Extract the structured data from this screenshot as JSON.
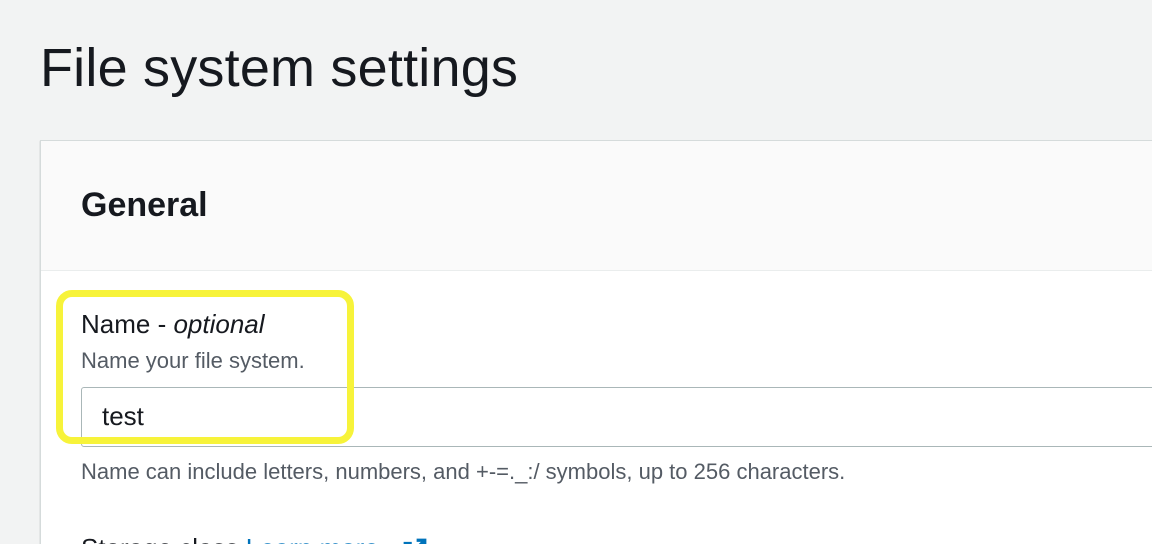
{
  "page": {
    "title": "File system settings"
  },
  "general": {
    "title": "General",
    "name_field": {
      "label": "Name - ",
      "label_optional": "optional",
      "description": "Name your file system.",
      "value": "test",
      "constraint": "Name can include letters, numbers, and +-=._:/ symbols, up to 256 characters."
    },
    "next_field": {
      "label": "Storage class",
      "info_link": "Learn more",
      "icon": "external-link-icon"
    }
  },
  "colors": {
    "highlight": "#f7f33a",
    "link": "#0073bb",
    "background": "#f2f3f3"
  }
}
